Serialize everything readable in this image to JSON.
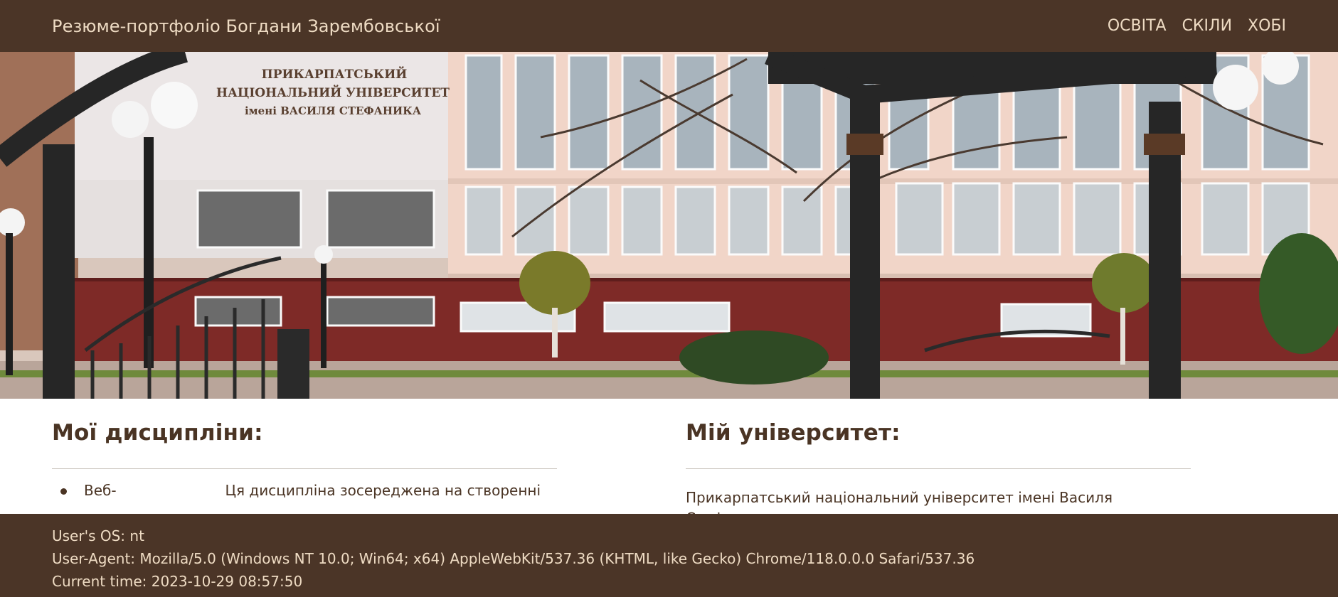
{
  "navbar": {
    "brand": "Резюме-портфоліо Богдани Зарембовської",
    "links": [
      "ОСВІТА",
      "СКІЛИ",
      "ХОБІ"
    ]
  },
  "hero": {
    "sign_lines": [
      "ПРИКАРПАТСЬКИЙ",
      "НАЦІОНАЛЬНИЙ УНІВЕРСИТЕТ",
      "імені ВАСИЛЯ СТЕФАНИКА"
    ]
  },
  "disciplines": {
    "title": "Мої дисципліни:",
    "items": [
      {
        "name": "Веб-",
        "description": "Ця дисципліна зосереджена на створенні"
      }
    ]
  },
  "university": {
    "title": "Мій університет:",
    "text": "Прикарпатський національний університет імені Василя Стефаника є"
  },
  "footer": {
    "os": "User's OS: nt",
    "user_agent": "User-Agent: Mozilla/5.0 (Windows NT 10.0; Win64; x64) AppleWebKit/537.36 (KHTML, like Gecko) Chrome/118.0.0.0 Safari/537.36",
    "time": "Current time: 2023-10-29 08:57:50"
  },
  "colors": {
    "navbar_bg": "#4b3527",
    "nav_text": "#eedbc3",
    "heading": "#4a3424",
    "building_wall": "#f2d5c8",
    "building_base": "#7e2a27"
  }
}
